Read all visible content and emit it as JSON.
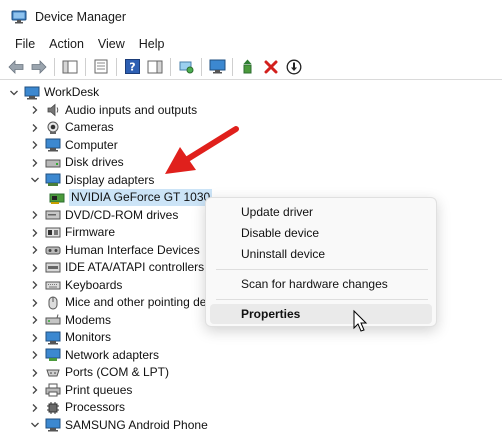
{
  "window": {
    "title": "Device Manager"
  },
  "menu": [
    "File",
    "Action",
    "View",
    "Help"
  ],
  "toolbar": {
    "icons": [
      "back-arrow-icon",
      "forward-arrow-icon",
      "show-hide-tree-icon",
      "properties-sheet-icon",
      "help-icon",
      "action-pane-icon",
      "scan-hardware-icon",
      "monitor-icon",
      "update-driver-icon",
      "uninstall-x-icon",
      "disable-device-icon"
    ]
  },
  "tree": {
    "root": "WorkDesk",
    "items": [
      {
        "label": "Audio inputs and outputs",
        "icon": "speaker-icon"
      },
      {
        "label": "Cameras",
        "icon": "camera-icon"
      },
      {
        "label": "Computer",
        "icon": "computer-icon"
      },
      {
        "label": "Disk drives",
        "icon": "disk-drive-icon"
      },
      {
        "label": "Display adapters",
        "icon": "display-adapter-icon",
        "expanded": true
      },
      {
        "label": "DVD/CD-ROM drives",
        "icon": "dvd-icon"
      },
      {
        "label": "Firmware",
        "icon": "firmware-icon"
      },
      {
        "label": "Human Interface Devices",
        "icon": "hid-icon"
      },
      {
        "label": "IDE ATA/ATAPI controllers",
        "icon": "ide-controller-icon"
      },
      {
        "label": "Keyboards",
        "icon": "keyboard-icon"
      },
      {
        "label": "Mice and other pointing de",
        "icon": "mouse-icon"
      },
      {
        "label": "Modems",
        "icon": "modem-icon"
      },
      {
        "label": "Monitors",
        "icon": "monitor-icon"
      },
      {
        "label": "Network adapters",
        "icon": "network-adapter-icon"
      },
      {
        "label": "Ports (COM & LPT)",
        "icon": "port-icon"
      },
      {
        "label": "Print queues",
        "icon": "printer-icon"
      },
      {
        "label": "Processors",
        "icon": "processor-icon"
      },
      {
        "label": "SAMSUNG Android Phone",
        "icon": "phone-icon"
      }
    ],
    "child": {
      "label": "NVIDIA GeForce GT 1030",
      "icon": "gpu-icon",
      "selected": true
    }
  },
  "context_menu": {
    "items": [
      "Update driver",
      "Disable device",
      "Uninstall device",
      "Scan for hardware changes",
      "Properties"
    ],
    "highlighted": "Properties"
  },
  "colors": {
    "annotation_arrow": "#e0201c",
    "selection": "#cce4f7",
    "menu_highlight": "#eaeaea"
  }
}
